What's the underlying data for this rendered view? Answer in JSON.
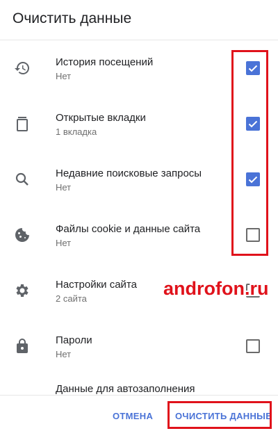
{
  "dialog": {
    "title": "Очистить данные"
  },
  "items": [
    {
      "icon": "history-icon",
      "label": "История посещений",
      "sub": "Нет",
      "checked": true
    },
    {
      "icon": "tabs-icon",
      "label": "Открытые вкладки",
      "sub": "1 вкладка",
      "checked": true
    },
    {
      "icon": "search-icon",
      "label": "Недавние поисковые запросы",
      "sub": "Нет",
      "checked": true
    },
    {
      "icon": "cookie-icon",
      "label": "Файлы cookie и данные сайта",
      "sub": "Нет",
      "checked": false
    },
    {
      "icon": "gear-icon",
      "label": "Настройки сайта",
      "sub": "2 сайта",
      "checked": false
    },
    {
      "icon": "lock-icon",
      "label": "Пароли",
      "sub": "Нет",
      "checked": false
    },
    {
      "icon": "autofill-icon",
      "label": "Данные для автозаполнения",
      "sub": "",
      "checked": false
    }
  ],
  "watermark": "androfon.ru",
  "footer": {
    "cancel_label": "ОТМЕНА",
    "clear_label": "ОЧИСТИТЬ ДАННЫЕ"
  },
  "colors": {
    "accent": "#4a73d7",
    "highlight": "#e0121b",
    "text": "#202124",
    "secondary": "#6f6f6f"
  }
}
